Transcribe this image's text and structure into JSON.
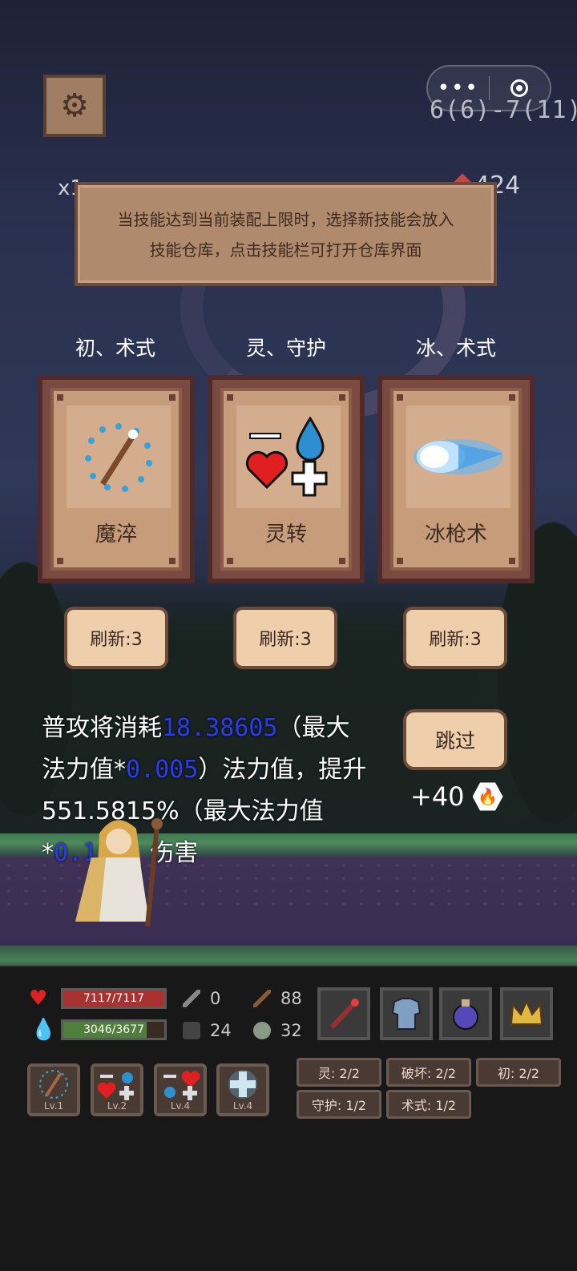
{
  "hud": {
    "stage": "6(6)-7(11)",
    "multiplier": "x1",
    "gems": "424"
  },
  "tip": {
    "line1": "当技能达到当前装配上限时，选择新技能会放入",
    "line2": "技能仓库，点击技能栏可打开仓库界面"
  },
  "cards": [
    {
      "type": "初、术式",
      "name": "魔淬",
      "icon": "staff-water-circle-icon",
      "refresh": "刷新:3"
    },
    {
      "type": "灵、守护",
      "name": "灵转",
      "icon": "mana-heal-icon",
      "refresh": "刷新:3"
    },
    {
      "type": "冰、术式",
      "name": "冰枪术",
      "icon": "ice-lance-icon",
      "refresh": "刷新:3"
    }
  ],
  "description": {
    "p1": "普攻将消耗",
    "n1": "18.38605",
    "p2": "（最大法力值*",
    "n2": "0.005",
    "p3": "）法力值，提升551.5815%（最大法力值*",
    "n3": "0.15%",
    "p4": "）伤害"
  },
  "skip_label": "跳过",
  "bonus": "+40",
  "player": {
    "hp_text": "7117/7117",
    "hp_fraction": 1.0,
    "mp_text": "3046/3677",
    "mp_fraction": 0.828,
    "attack": "0",
    "magic": "88",
    "defense": "24",
    "resist": "32"
  },
  "equipment": [
    "staff-icon",
    "armor-icon",
    "potion-icon",
    "crown-icon"
  ],
  "skill_slots": [
    {
      "icon": "staff-water-circle-icon",
      "level": "Lv.1"
    },
    {
      "icon": "mana-heal-icon",
      "level": "Lv.2"
    },
    {
      "icon": "mana-heal-icon",
      "level": "Lv.4"
    },
    {
      "icon": "heal-cross-icon",
      "level": "Lv.4"
    }
  ],
  "tags": [
    "灵: 2/2",
    "破坏: 2/2",
    "初: 2/2",
    "守护: 1/2",
    "术式: 1/2"
  ],
  "colors": {
    "accent_blue": "#2b3cf0",
    "hp": "#a8322f",
    "mp": "#4f7f3a"
  }
}
